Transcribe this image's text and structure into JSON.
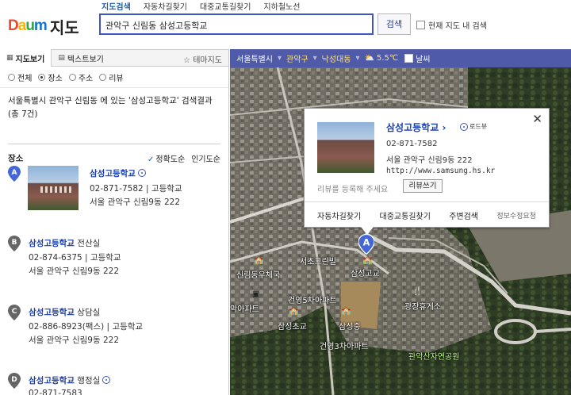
{
  "logo": {
    "brand": "Daum",
    "title": "지도"
  },
  "topnav": [
    "지도검색",
    "자동차길찾기",
    "대중교통길찾기",
    "지하철노선"
  ],
  "search": {
    "value": "관악구 신림동 삼성고등학교",
    "button": "검색",
    "in_map_label": "현재 지도 내 검색"
  },
  "left_tabs": {
    "map_view": "지도보기",
    "text_view": "텍스트보기",
    "theme_map": "테마지도"
  },
  "filters": [
    "전체",
    "장소",
    "주소",
    "리뷰"
  ],
  "selected_filter": "장소",
  "summary": {
    "line1_prefix": "서울특별시 관악구 신림동",
    "line1_mid": " 에 있는 ",
    "line1_query": "'삼성고등학교'",
    "line1_suffix": " 검색결과",
    "line2": "(총 7건)"
  },
  "list_header": {
    "title": "장소",
    "sort_accuracy": "정확도순",
    "sort_popular": "인기도순"
  },
  "results": [
    {
      "marker": "A",
      "name": "삼성고등학교",
      "sub": "",
      "phone": "02-871-7582",
      "category": "고등학교",
      "address": "서울 관악구 신림9동 222"
    },
    {
      "marker": "B",
      "name": "삼성고등학교",
      "sub": " 전산실",
      "phone": "02-874-6375",
      "category": "고등학교",
      "address": "서울 관악구 신림9동 222"
    },
    {
      "marker": "C",
      "name": "삼성고등학교",
      "sub": " 상담실",
      "phone": "02-886-8923(팩스)",
      "category": "고등학교",
      "address": "서울 관악구 신림9동 222"
    },
    {
      "marker": "D",
      "name": "삼성고등학교",
      "sub": " 행정실",
      "phone": "02-871-7583",
      "category": "",
      "address": ""
    }
  ],
  "mapbar": {
    "crumbs": [
      "서울특별시",
      "관악구",
      "낙성대동"
    ],
    "weather": "5.5℃",
    "satellite": "날씨"
  },
  "map_labels": [
    "서초그린빌",
    "신림동우체국",
    "삼성고교",
    "악아파트",
    "건영5차아파트",
    "광장휴게소",
    "삼성초교",
    "삼성중",
    "건영3차아파트",
    "관악산자연공원"
  ],
  "popup": {
    "name": "삼성고등학교",
    "roadview": "로드뷰",
    "phone": "02-871-7582",
    "address": "서울 관악구 신림9동 222",
    "url": "http://www.samsung.hs.kr",
    "review_hint": "리뷰를 등록해 주세요",
    "review_button": "리뷰쓰기",
    "actions": [
      "자동차길찾기",
      "대중교통길찾기",
      "주변검색",
      "정보수정요청"
    ]
  },
  "map_marker": "A",
  "colors": {
    "accent": "#3f55c6",
    "mapbar": "#4f5aa8",
    "marker": "#4466d6"
  }
}
